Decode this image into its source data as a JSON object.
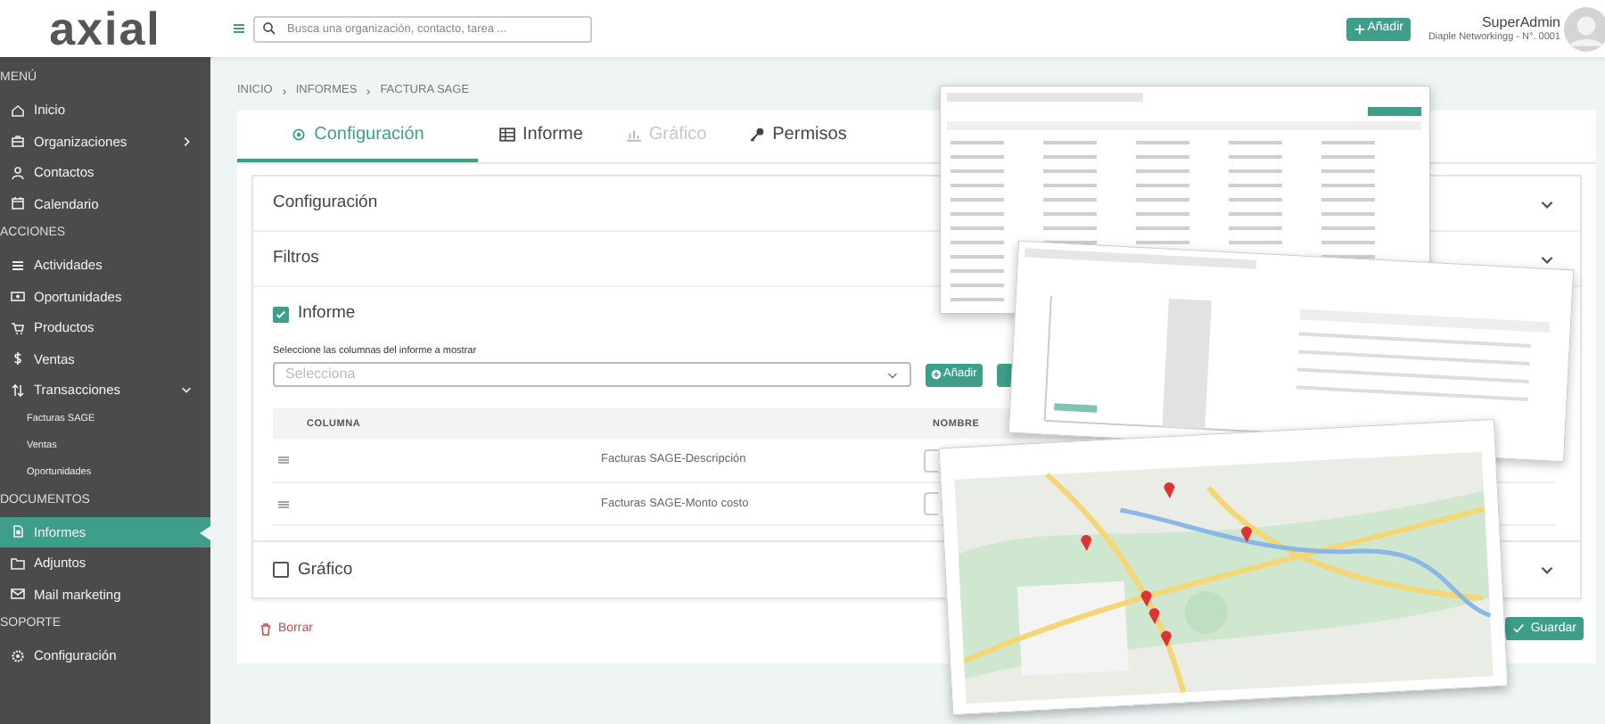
{
  "logo": {
    "text": "axial"
  },
  "header": {
    "search_placeholder": "Busca una organización, contacto, tarea ...",
    "add_button": "Añadir",
    "user_name": "SuperAdmin",
    "company": "Diaple Networkingg - N°. 0001"
  },
  "sidebar": [
    {
      "title": "MENÚ",
      "items": [
        {
          "label": "Inicio",
          "selected": false
        },
        {
          "label": "Organizaciones",
          "selected": false,
          "expanded": false
        },
        {
          "label": "Contactos",
          "selected": false
        },
        {
          "label": "Calendario",
          "selected": false
        }
      ]
    },
    {
      "title": "ACCIONES",
      "items": [
        {
          "label": "Actividades",
          "selected": false
        },
        {
          "label": "Oportunidades",
          "selected": false
        },
        {
          "label": "Productos",
          "selected": false
        },
        {
          "label": "Ventas",
          "selected": false
        },
        {
          "label": "Transacciones",
          "selected": false,
          "expanded": true,
          "children": [
            {
              "label": "Facturas SAGE"
            },
            {
              "label": "Ventas"
            },
            {
              "label": "Oportunidades"
            }
          ]
        }
      ]
    },
    {
      "title": "DOCUMENTOS",
      "items": [
        {
          "label": "Informes",
          "selected": true
        },
        {
          "label": "Adjuntos",
          "selected": false
        },
        {
          "label": "Mail marketing",
          "selected": false
        }
      ]
    },
    {
      "title": "SOPORTE",
      "items": [
        {
          "label": "Configuración",
          "selected": false
        }
      ]
    }
  ],
  "breadcrumb": [
    "INICIO",
    "INFORMES",
    "FACTURA SAGE"
  ],
  "tabs": [
    {
      "label": "Configuración",
      "selected": true,
      "disabled": false
    },
    {
      "label": "Informe",
      "selected": false,
      "disabled": false
    },
    {
      "label": "Gráfico",
      "selected": false,
      "disabled": true
    },
    {
      "label": "Permisos",
      "selected": false,
      "disabled": false
    }
  ],
  "panels": [
    {
      "title": "Configuración"
    },
    {
      "title": "Filtros"
    }
  ],
  "report": {
    "label": "Informe",
    "checked": true,
    "select_label": "Seleccione las columnas del informe a mostrar",
    "select_placeholder": "Selecciona",
    "add_button": "Añadir",
    "columns": [
      "COLUMNA",
      "NOMBRE"
    ],
    "rows": [
      {
        "column": "Facturas SAGE-Descripción"
      },
      {
        "column": "Facturas SAGE-Monto costo"
      }
    ]
  },
  "chart_option": {
    "label": "Gráfico",
    "checked": false
  },
  "delete_button": "Borrar",
  "save_button": "Guardar"
}
